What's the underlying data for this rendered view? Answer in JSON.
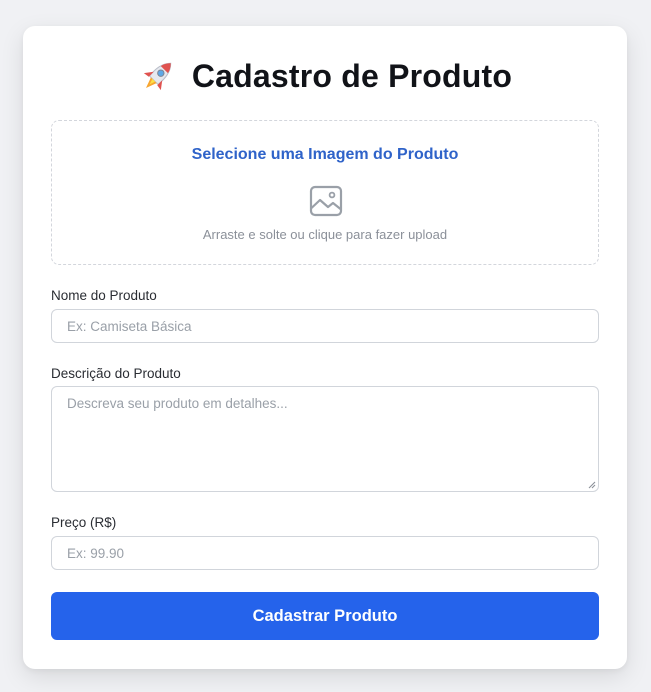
{
  "header": {
    "icon": "rocket-icon",
    "title": "Cadastro de Produto"
  },
  "upload": {
    "title": "Selecione uma Imagem do Produto",
    "icon": "image-icon",
    "hint": "Arraste e solte ou clique para fazer upload"
  },
  "form": {
    "name": {
      "label": "Nome do Produto",
      "value": "",
      "placeholder": "Ex: Camiseta Básica"
    },
    "description": {
      "label": "Descrição do Produto",
      "value": "",
      "placeholder": "Descreva seu produto em detalhes..."
    },
    "price": {
      "label": "Preço (R$)",
      "value": "",
      "placeholder": "Ex: 99.90"
    },
    "submit_label": "Cadastrar Produto"
  },
  "colors": {
    "accent": "#2563eb",
    "upload_title": "#2f63c9",
    "page_background": "#f0f1f4"
  }
}
